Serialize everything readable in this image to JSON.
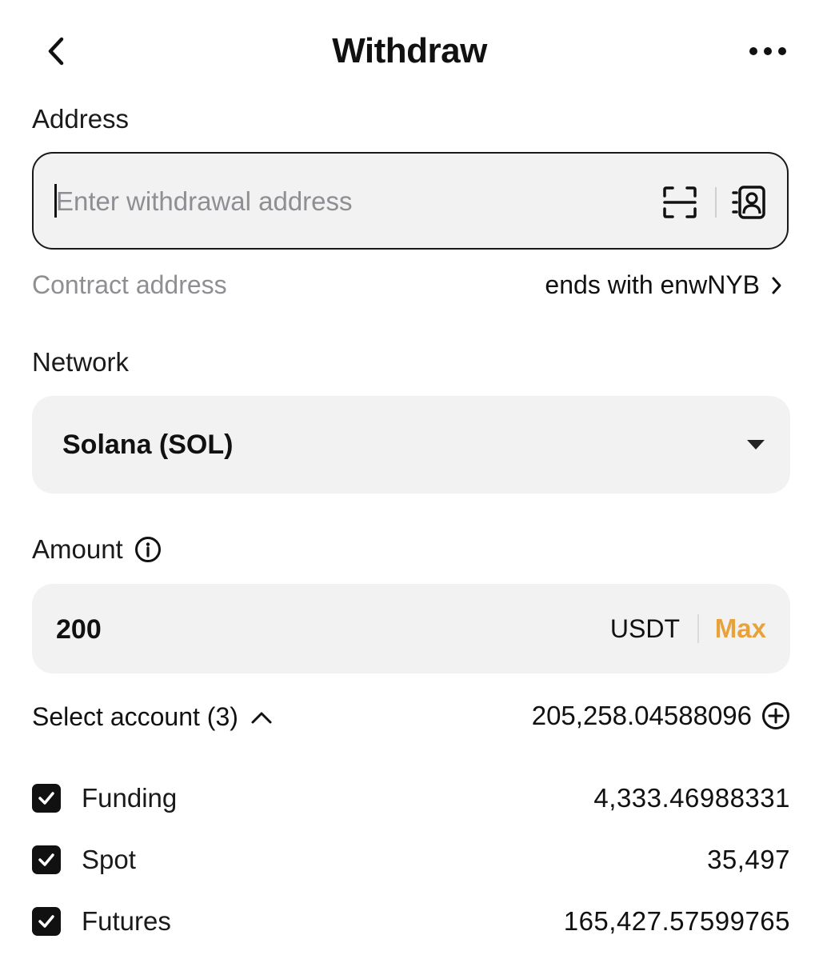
{
  "header": {
    "title": "Withdraw"
  },
  "address": {
    "label": "Address",
    "placeholder": "Enter withdrawal address",
    "value": ""
  },
  "contract": {
    "label": "Contract address",
    "value": "ends with enwNYB"
  },
  "network": {
    "label": "Network",
    "selected": "Solana (SOL)"
  },
  "amount": {
    "label": "Amount",
    "value": "200",
    "currency": "USDT",
    "max_label": "Max"
  },
  "accounts": {
    "label": "Select account (3)",
    "total": "205,258.04588096",
    "items": [
      {
        "name": "Funding",
        "amount": "4,333.46988331",
        "checked": true
      },
      {
        "name": "Spot",
        "amount": "35,497",
        "checked": true
      },
      {
        "name": "Futures",
        "amount": "165,427.57599765",
        "checked": true
      }
    ]
  },
  "colors": {
    "accent": "#e8a23a",
    "field_bg": "#f2f2f3",
    "muted_text": "#8e8e93"
  }
}
